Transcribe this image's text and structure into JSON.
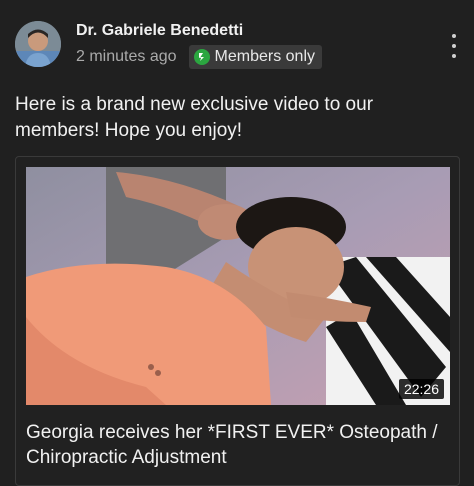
{
  "post": {
    "channel_name": "Dr. Gabriele Benedetti",
    "time": "2 minutes ago",
    "badge_label": "Members only",
    "text": "Here is a brand new exclusive video to our members! Hope you enjoy!"
  },
  "video": {
    "duration": "22:26",
    "title": "Georgia receives her *FIRST EVER* Osteopath / Chiropractic Adjustment"
  },
  "icons": {
    "avatar": "profile-photo",
    "badge": "members-badge-icon",
    "menu": "more-vertical-icon"
  },
  "colors": {
    "background": "#202020",
    "badge_green": "#2ba640",
    "secondary_text": "#aaaaaa"
  }
}
